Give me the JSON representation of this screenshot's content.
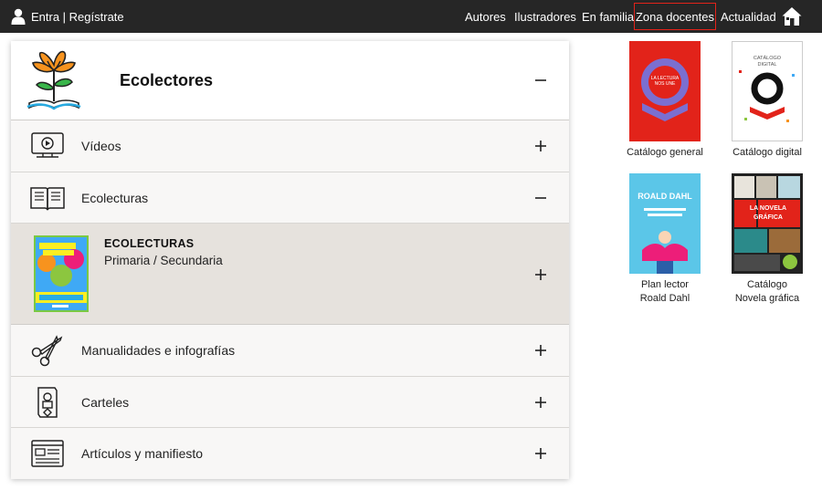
{
  "header": {
    "login_label": "Entra | Regístrate",
    "nav": [
      "Autores",
      "Ilustradores",
      "En familia"
    ],
    "nav_highlight": "Zona docentes",
    "nav_last": "Actualidad",
    "accent_color": "#e2231a"
  },
  "panel": {
    "title": "Ecolectores",
    "rows": [
      {
        "label": "Vídeos",
        "icon": "video-icon"
      },
      {
        "label": "Ecolecturas",
        "icon": "open-book-icon"
      },
      {
        "label": "Manualidades e infografías",
        "icon": "scissors-icon"
      },
      {
        "label": "Carteles",
        "icon": "poster-icon"
      },
      {
        "label": "Artículos y manifiesto",
        "icon": "article-icon"
      }
    ],
    "expanded": {
      "title": "ECOLECTURAS",
      "subtitle": "Primaria / Secundaria",
      "cover_word": "ECOLECTORES"
    }
  },
  "catalogs": [
    {
      "label1": "Catálogo general",
      "label2": "",
      "cover_text": "LA LECTURA NOS UNE"
    },
    {
      "label1": "Catálogo digital",
      "label2": "",
      "cover_text": "CATÁLOGO DIGITAL"
    },
    {
      "label1": "Plan lector",
      "label2": "Roald Dahl",
      "cover_text": "ROALD DAHL"
    },
    {
      "label1": "Catálogo",
      "label2": "Novela gráfica",
      "cover_text": "LA NOVELA GRÁFICA EN EL AULA"
    }
  ]
}
